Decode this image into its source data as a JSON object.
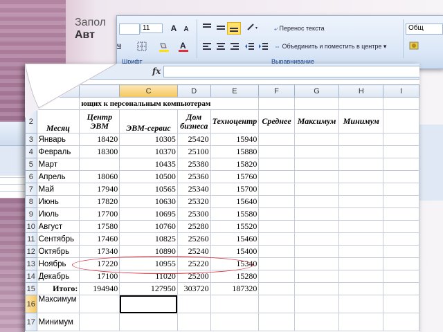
{
  "slide": {
    "title_line1": "Запол",
    "title_line2": "Авт"
  },
  "ribbon": {
    "font_name": "",
    "font_size": "11",
    "group_font": "Шрифт",
    "group_align": "Выравнивание",
    "wrap_text": "Перенос текста",
    "merge_center": "Объединить и поместить в центре",
    "right_box": "Общ",
    "bold_label": "ч",
    "grow_font": "A",
    "shrink_font": "A"
  },
  "formula_bar": {
    "fx": "fx",
    "value": ""
  },
  "sheet": {
    "col_headers": [
      "C",
      "D",
      "E",
      "F",
      "G",
      "H",
      "I"
    ],
    "title_row_text": "ющих к персональным компьютерам",
    "header_row": {
      "num": "2",
      "month": "Месяц",
      "b": "Центр ЭВМ",
      "c": "ЭВМ-сервис",
      "d": "Дом бизнеса",
      "e": "Техноцентр",
      "f": "Среднее",
      "g": "Максимум",
      "h": "Минимум"
    },
    "rows": [
      {
        "num": "3",
        "month": "Январь",
        "b": "18420",
        "c": "10305",
        "d": "25420",
        "e": "15940"
      },
      {
        "num": "4",
        "month": "Февраль",
        "b": "18300",
        "c": "10370",
        "d": "25100",
        "e": "15880"
      },
      {
        "num": "5",
        "month": "Март",
        "b": "",
        "c": "10435",
        "d": "25380",
        "e": "15820"
      },
      {
        "num": "6",
        "month": "Апрель",
        "b": "18060",
        "c": "10500",
        "d": "25360",
        "e": "15760"
      },
      {
        "num": "7",
        "month": "Май",
        "b": "17940",
        "c": "10565",
        "d": "25340",
        "e": "15700"
      },
      {
        "num": "8",
        "month": "Июнь",
        "b": "17820",
        "c": "10630",
        "d": "25320",
        "e": "15640"
      },
      {
        "num": "9",
        "month": "Июль",
        "b": "17700",
        "c": "10695",
        "d": "25300",
        "e": "15580"
      },
      {
        "num": "10",
        "month": "Август",
        "b": "17580",
        "c": "10760",
        "d": "25280",
        "e": "15520"
      },
      {
        "num": "11",
        "month": "Сентябрь",
        "b": "17460",
        "c": "10825",
        "d": "25260",
        "e": "15460"
      },
      {
        "num": "12",
        "month": "Октябрь",
        "b": "17340",
        "c": "10890",
        "d": "25240",
        "e": "15400"
      },
      {
        "num": "13",
        "month": "Ноябрь",
        "b": "17220",
        "c": "10955",
        "d": "25220",
        "e": "15340"
      },
      {
        "num": "14",
        "month": "Декабрь",
        "b": "17100",
        "c": "11020",
        "d": "25200",
        "e": "15280"
      }
    ],
    "total_row": {
      "num": "15",
      "label": "Итого:",
      "b": "194940",
      "c": "127950",
      "d": "303720",
      "e": "187320"
    },
    "max_row": {
      "num": "16",
      "label": "Максимум"
    },
    "min_row": {
      "num": "17",
      "label": "Минимум"
    }
  },
  "colors": {
    "accent_red": "#e0303a",
    "ribbon_blue": "#15428b"
  }
}
